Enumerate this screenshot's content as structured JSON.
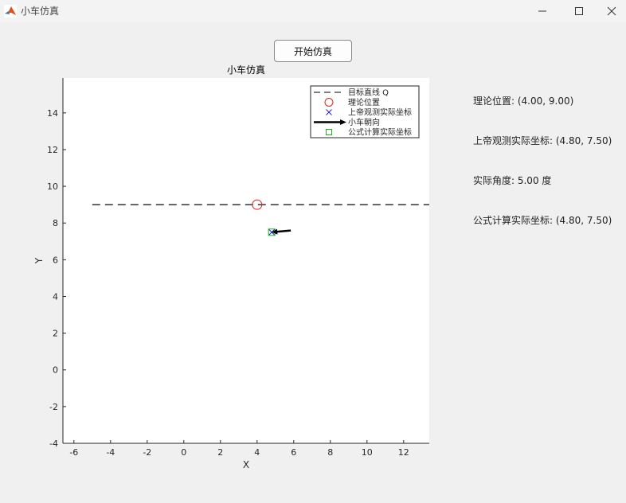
{
  "window": {
    "title": "小车仿真"
  },
  "controls": {
    "start_label": "开始仿真"
  },
  "info": {
    "theoretical_position": "理论位置: (4.00, 9.00)",
    "god_view_position": "上帝观测实际坐标: (4.80, 7.50)",
    "actual_angle": "实际角度: 5.00 度",
    "formula_position": "公式计算实际坐标: (4.80, 7.50)"
  },
  "chart_data": {
    "type": "scatter",
    "title": "小车仿真",
    "xlabel": "X",
    "ylabel": "Y",
    "xlim": [
      -6.6,
      13.4
    ],
    "ylim": [
      -4,
      15.9
    ],
    "xticks": [
      -6,
      -4,
      -2,
      0,
      2,
      4,
      6,
      8,
      10,
      12
    ],
    "yticks": [
      -4,
      -2,
      0,
      2,
      4,
      6,
      8,
      10,
      12,
      14
    ],
    "grid": false,
    "legend_position": "top-right",
    "series": [
      {
        "name": "目标直线 Q",
        "kind": "dashed-line",
        "color": "#333333",
        "x": [
          -5,
          13.4
        ],
        "y": [
          9,
          9
        ]
      },
      {
        "name": "理论位置",
        "kind": "circle-marker",
        "color": "#e02020",
        "x": [
          4.0
        ],
        "y": [
          9.0
        ]
      },
      {
        "name": "上帝观测实际坐标",
        "kind": "x-marker",
        "color": "#2020d0",
        "x": [
          4.8
        ],
        "y": [
          7.5
        ]
      },
      {
        "name": "小车朝向",
        "kind": "arrow",
        "color": "#000000",
        "x": [
          4.8
        ],
        "y": [
          7.5
        ],
        "angle_deg": 5
      },
      {
        "name": "公式计算实际坐标",
        "kind": "square-marker",
        "color": "#20b020",
        "x": [
          4.8
        ],
        "y": [
          7.5
        ]
      }
    ]
  }
}
